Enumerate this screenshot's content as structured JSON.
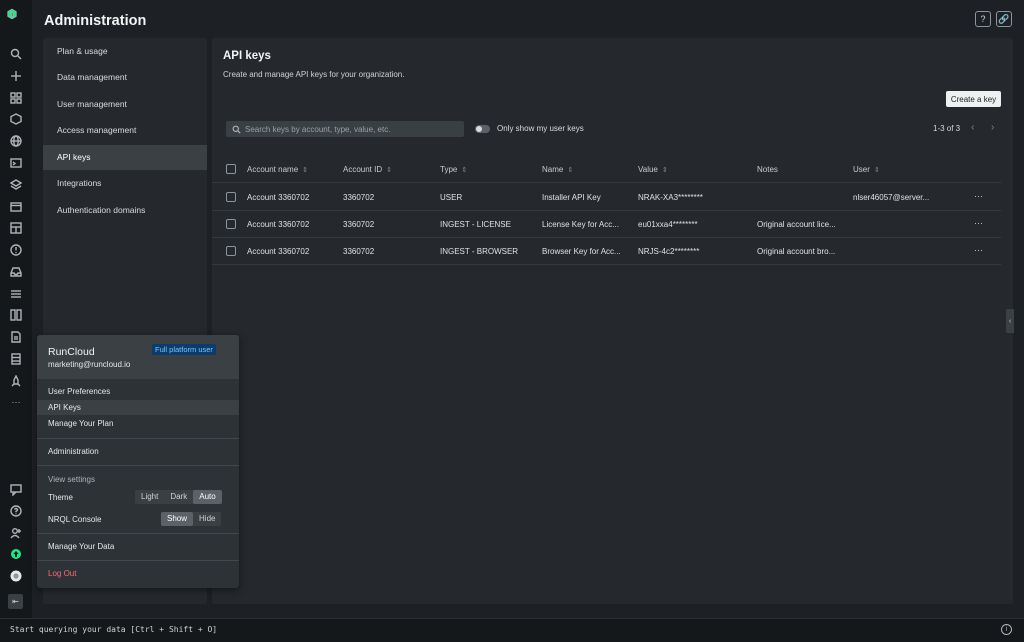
{
  "header": {
    "title": "Administration",
    "help_icon": "help-icon",
    "link_icon": "link-icon"
  },
  "rail": {
    "icons": [
      "search-icon",
      "add-icon",
      "apps-icon",
      "entities-icon",
      "globe-icon",
      "terminal-icon",
      "layers-icon",
      "browser-icon",
      "dashboard-icon",
      "alert-icon",
      "inbox-icon",
      "sliders-icon",
      "columns-icon",
      "doc-icon",
      "storage-icon",
      "rocket-icon",
      "more-icon"
    ],
    "bottom_icons": [
      "feedback-icon",
      "help-circle-icon",
      "add-user-icon",
      "upgrade-icon",
      "avatar-icon",
      "collapse-icon"
    ],
    "more_label": "···"
  },
  "sidebar": {
    "items": [
      {
        "label": "Plan & usage",
        "active": false
      },
      {
        "label": "Data management",
        "active": false
      },
      {
        "label": "User management",
        "active": false
      },
      {
        "label": "Access management",
        "active": false
      },
      {
        "label": "API keys",
        "active": true
      },
      {
        "label": "Integrations",
        "active": false
      },
      {
        "label": "Authentication domains",
        "active": false
      }
    ]
  },
  "main": {
    "title": "API keys",
    "subtitle": "Create and manage API keys for your organization.",
    "create_button": "Create a key",
    "search_placeholder": "Search keys by account, type, value, etc.",
    "toggle_label": "Only show my user keys",
    "pager": "1-3 of 3",
    "columns": [
      "Account name",
      "Account ID",
      "Type",
      "Name",
      "Value",
      "Notes",
      "User"
    ],
    "rows": [
      [
        "Account 3360702",
        "3360702",
        "USER",
        "Installer API Key",
        "NRAK-XA3********",
        "",
        "nlser46057@server..."
      ],
      [
        "Account 3360702",
        "3360702",
        "INGEST - LICENSE",
        "License Key for Acc...",
        "eu01xxa4********",
        "Original account lice...",
        ""
      ],
      [
        "Account 3360702",
        "3360702",
        "INGEST - BROWSER",
        "Browser Key for Acc...",
        "NRJS-4c2********",
        "Original account bro...",
        ""
      ]
    ],
    "row_menu": "···"
  },
  "popup": {
    "name": "RunCloud",
    "email": "marketing@runcloud.io",
    "badge": "Full platform user",
    "items": [
      "User Preferences",
      "API Keys",
      "Manage Your Plan"
    ],
    "admin": "Administration",
    "view_settings": "View settings",
    "theme_label": "Theme",
    "theme_options": [
      "Light",
      "Dark",
      "Auto"
    ],
    "theme_selected": "Auto",
    "nrql_label": "NRQL Console",
    "nrql_options": [
      "Show",
      "Hide"
    ],
    "nrql_selected": "Show",
    "manage_data": "Manage Your Data",
    "logout": "Log Out"
  },
  "bottom": {
    "text": "Start querying your data [Ctrl + Shift + O]"
  },
  "colors": {
    "background": "#1d2125",
    "panel": "#25292d",
    "accent_badge": "#0b3c6b",
    "logout": "#ff6b6b",
    "logo": "#1ce783"
  }
}
